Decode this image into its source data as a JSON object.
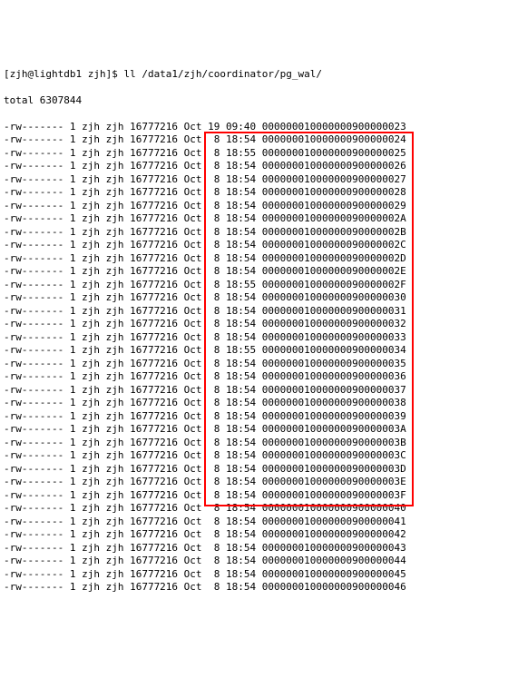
{
  "prompt": {
    "user": "zjh",
    "host": "lightdb1",
    "cwd_short": "zjh",
    "command": "ll /data1/zjh/coordinator/pg_wal/",
    "full_line": "[zjh@lightdb1 zjh]$ ll /data1/zjh/coordinator/pg_wal/"
  },
  "total_line": "total 6307844",
  "common": {
    "perms": "-rw-------",
    "links": "1",
    "owner": "zjh",
    "group": "zjh",
    "size": "16777216",
    "month": "Oct"
  },
  "rows": [
    {
      "day": "19",
      "time": "09:40",
      "file": "000000010000000900000023",
      "hl": false
    },
    {
      "day": " 8",
      "time": "18:54",
      "file": "000000010000000900000024",
      "hl": true
    },
    {
      "day": " 8",
      "time": "18:55",
      "file": "000000010000000900000025",
      "hl": true
    },
    {
      "day": " 8",
      "time": "18:54",
      "file": "000000010000000900000026",
      "hl": true
    },
    {
      "day": " 8",
      "time": "18:54",
      "file": "000000010000000900000027",
      "hl": true
    },
    {
      "day": " 8",
      "time": "18:54",
      "file": "000000010000000900000028",
      "hl": true
    },
    {
      "day": " 8",
      "time": "18:54",
      "file": "000000010000000900000029",
      "hl": true
    },
    {
      "day": " 8",
      "time": "18:54",
      "file": "00000001000000090000002A",
      "hl": true
    },
    {
      "day": " 8",
      "time": "18:54",
      "file": "00000001000000090000002B",
      "hl": true
    },
    {
      "day": " 8",
      "time": "18:54",
      "file": "00000001000000090000002C",
      "hl": true
    },
    {
      "day": " 8",
      "time": "18:54",
      "file": "00000001000000090000002D",
      "hl": true
    },
    {
      "day": " 8",
      "time": "18:54",
      "file": "00000001000000090000002E",
      "hl": true
    },
    {
      "day": " 8",
      "time": "18:55",
      "file": "00000001000000090000002F",
      "hl": true
    },
    {
      "day": " 8",
      "time": "18:54",
      "file": "000000010000000900000030",
      "hl": true
    },
    {
      "day": " 8",
      "time": "18:54",
      "file": "000000010000000900000031",
      "hl": true
    },
    {
      "day": " 8",
      "time": "18:54",
      "file": "000000010000000900000032",
      "hl": true
    },
    {
      "day": " 8",
      "time": "18:54",
      "file": "000000010000000900000033",
      "hl": true
    },
    {
      "day": " 8",
      "time": "18:55",
      "file": "000000010000000900000034",
      "hl": true
    },
    {
      "day": " 8",
      "time": "18:54",
      "file": "000000010000000900000035",
      "hl": true
    },
    {
      "day": " 8",
      "time": "18:54",
      "file": "000000010000000900000036",
      "hl": true
    },
    {
      "day": " 8",
      "time": "18:54",
      "file": "000000010000000900000037",
      "hl": true
    },
    {
      "day": " 8",
      "time": "18:54",
      "file": "000000010000000900000038",
      "hl": true
    },
    {
      "day": " 8",
      "time": "18:54",
      "file": "000000010000000900000039",
      "hl": true
    },
    {
      "day": " 8",
      "time": "18:54",
      "file": "00000001000000090000003A",
      "hl": true
    },
    {
      "day": " 8",
      "time": "18:54",
      "file": "00000001000000090000003B",
      "hl": true
    },
    {
      "day": " 8",
      "time": "18:54",
      "file": "00000001000000090000003C",
      "hl": true
    },
    {
      "day": " 8",
      "time": "18:54",
      "file": "00000001000000090000003D",
      "hl": true
    },
    {
      "day": " 8",
      "time": "18:54",
      "file": "00000001000000090000003E",
      "hl": true
    },
    {
      "day": " 8",
      "time": "18:54",
      "file": "00000001000000090000003F",
      "hl": true
    },
    {
      "day": " 8",
      "time": "18:54",
      "file": "000000010000000900000040",
      "hl": false
    },
    {
      "day": " 8",
      "time": "18:54",
      "file": "000000010000000900000041",
      "hl": false
    },
    {
      "day": " 8",
      "time": "18:54",
      "file": "000000010000000900000042",
      "hl": false
    },
    {
      "day": " 8",
      "time": "18:54",
      "file": "000000010000000900000043",
      "hl": false
    },
    {
      "day": " 8",
      "time": "18:54",
      "file": "000000010000000900000044",
      "hl": false
    },
    {
      "day": " 8",
      "time": "18:54",
      "file": "000000010000000900000045",
      "hl": false
    },
    {
      "day": " 8",
      "time": "18:54",
      "file": "000000010000000900000046",
      "hl": false
    }
  ],
  "highlight": {
    "color": "#ff0000"
  }
}
